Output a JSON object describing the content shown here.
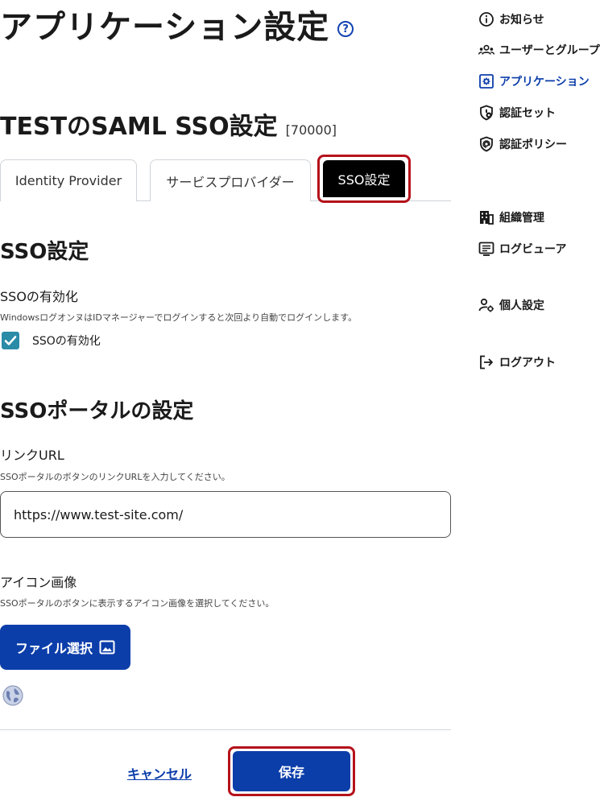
{
  "header": {
    "title": "アプリケーション設定",
    "help_glyph": "?"
  },
  "app": {
    "heading": "TESTのSAML SSO設定",
    "id": "[70000]"
  },
  "tabs": [
    {
      "label": "Identity Provider",
      "active": false
    },
    {
      "label": "サービスプロバイダー",
      "active": false
    },
    {
      "label": "SSO設定",
      "active": true
    }
  ],
  "sso_settings": {
    "section_title": "SSO設定",
    "enable_label": "SSOの有効化",
    "enable_help": "WindowsログオンヌはIDマネージャーでログインすると次回より自動でログインします。",
    "checkbox_label": "SSOの有効化",
    "checked": true
  },
  "portal": {
    "section_title": "SSOポータルの設定",
    "link_label": "リンクURL",
    "link_help": "SSOポータルのボタンのリンクURLを入力してください。",
    "link_value": "https://www.test-site.com/",
    "icon_label": "アイコン画像",
    "icon_help": "SSOポータルのボタンに表示するアイコン画像を選択してください。",
    "file_button_label": "ファイル選択"
  },
  "actions": {
    "cancel_label": "キャンセル",
    "save_label": "保存"
  },
  "nav": {
    "items": [
      {
        "label": "お知らせ",
        "icon": "info-icon",
        "active": false
      },
      {
        "label": "ユーザーとグループ",
        "icon": "users-icon",
        "active": false
      },
      {
        "label": "アプリケーション",
        "icon": "app-icon",
        "active": true
      },
      {
        "label": "認証セット",
        "icon": "shield-gear-icon",
        "active": false
      },
      {
        "label": "認証ポリシー",
        "icon": "shield-at-icon",
        "active": false
      },
      {
        "label": "組織管理",
        "icon": "building-icon",
        "active": false
      },
      {
        "label": "ログビューア",
        "icon": "log-icon",
        "active": false
      },
      {
        "label": "個人設定",
        "icon": "user-gear-icon",
        "active": false
      },
      {
        "label": "ログアウト",
        "icon": "logout-icon",
        "active": false
      }
    ]
  },
  "colors": {
    "brand_blue": "#0c3eaa",
    "highlight_red": "#b5121b",
    "checkbox_teal": "#2a8ca7"
  }
}
